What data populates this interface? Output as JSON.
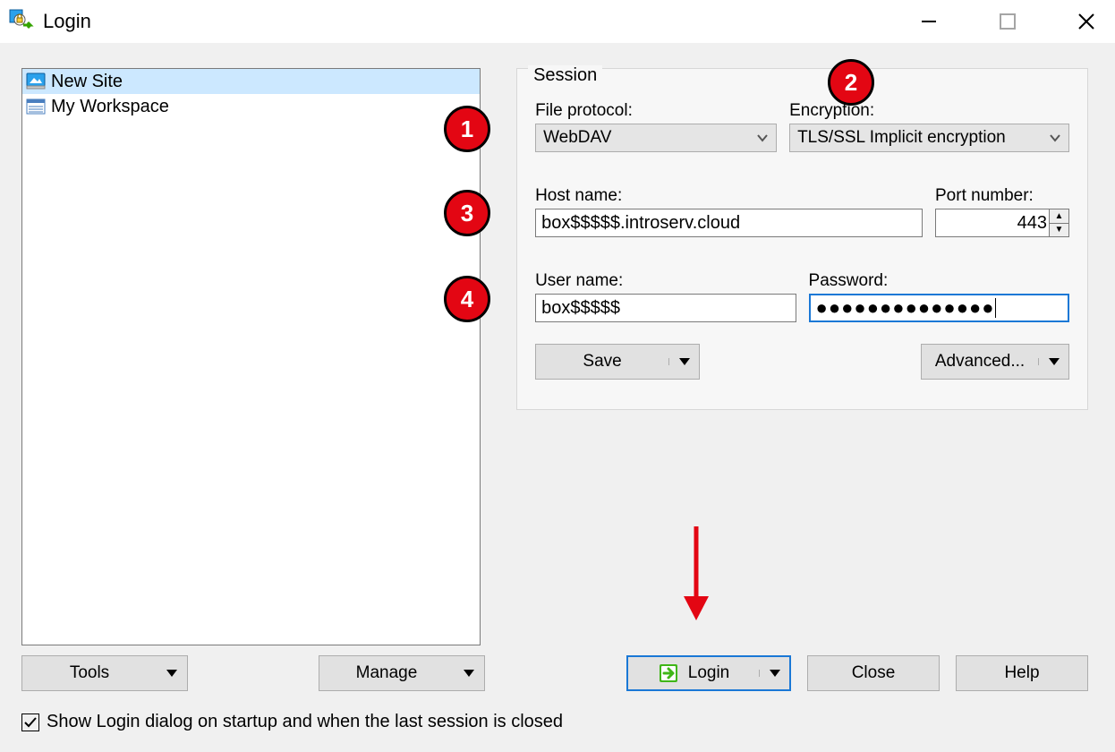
{
  "window": {
    "title": "Login"
  },
  "sidebar": {
    "items": [
      {
        "label": "New Site",
        "selected": true
      },
      {
        "label": "My Workspace",
        "selected": false
      }
    ]
  },
  "session": {
    "group_label": "Session",
    "file_protocol_label": "File protocol:",
    "file_protocol_value": "WebDAV",
    "encryption_label": "Encryption:",
    "encryption_value": "TLS/SSL Implicit encryption",
    "host_label": "Host name:",
    "host_value": "box$$$$$.introserv.cloud",
    "port_label": "Port number:",
    "port_value": "443",
    "user_label": "User name:",
    "user_value": "box$$$$$",
    "password_label": "Password:",
    "password_masked": "●●●●●●●●●●●●●●",
    "save_label": "Save",
    "advanced_label": "Advanced..."
  },
  "buttons": {
    "tools": "Tools",
    "manage": "Manage",
    "login": "Login",
    "close": "Close",
    "help": "Help"
  },
  "footer": {
    "checkbox_label": "Show Login dialog on startup and when the last session is closed"
  },
  "callouts": {
    "c1": "1",
    "c2": "2",
    "c3": "3",
    "c4": "4"
  }
}
